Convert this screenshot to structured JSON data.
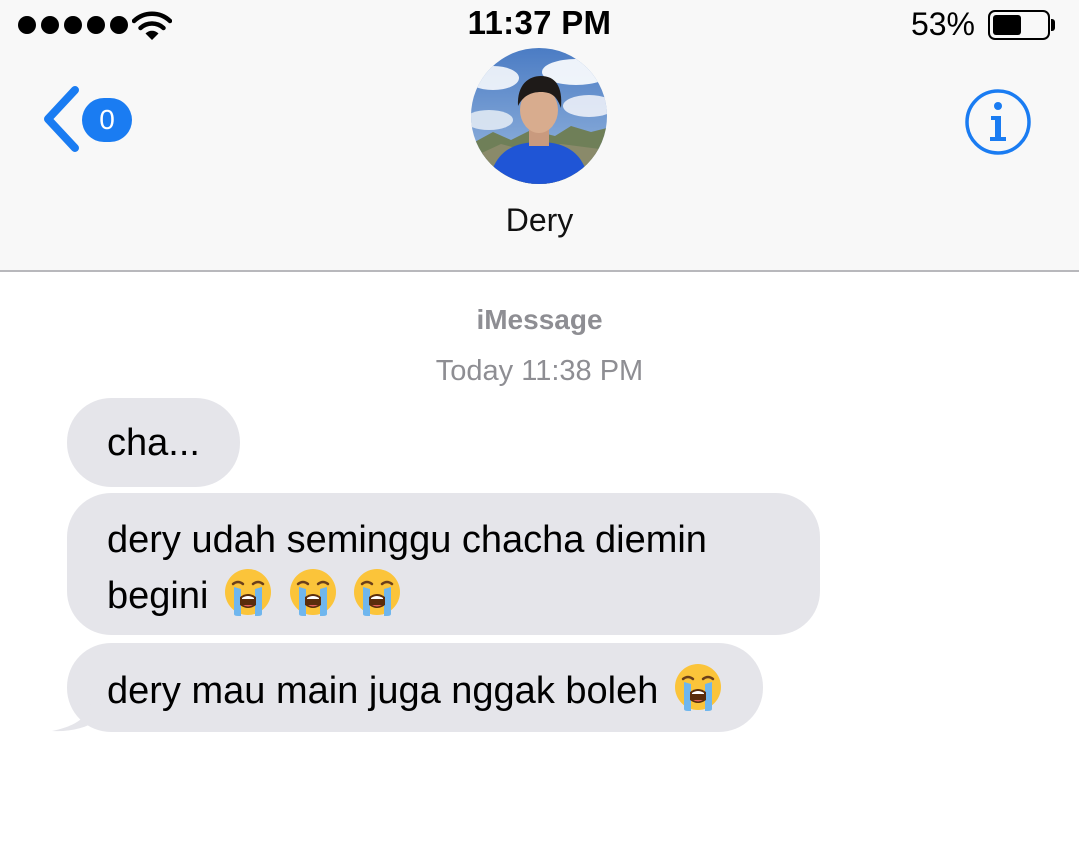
{
  "status_bar": {
    "time": "11:37 PM",
    "battery_percent": "53%",
    "battery_level": 0.53,
    "signal_bars": 5
  },
  "nav": {
    "back_badge": "0",
    "contact_name": "Dery",
    "accent_color": "#1a7cf2"
  },
  "conversation": {
    "service": "iMessage",
    "timestamp": "Today 11:38 PM",
    "bubble_color": "#e5e5ea",
    "messages": [
      {
        "text": "cha...",
        "emoji_count": 0
      },
      {
        "text": "dery udah seminggu chacha diemin begini",
        "emoji_count": 3
      },
      {
        "text": "dery mau main juga nggak boleh",
        "emoji_count": 1
      }
    ],
    "emoji_name": "loudly-crying-face"
  },
  "icons": {
    "back": "chevron-left-icon",
    "info": "info-icon",
    "wifi": "wifi-icon",
    "battery": "battery-icon"
  }
}
